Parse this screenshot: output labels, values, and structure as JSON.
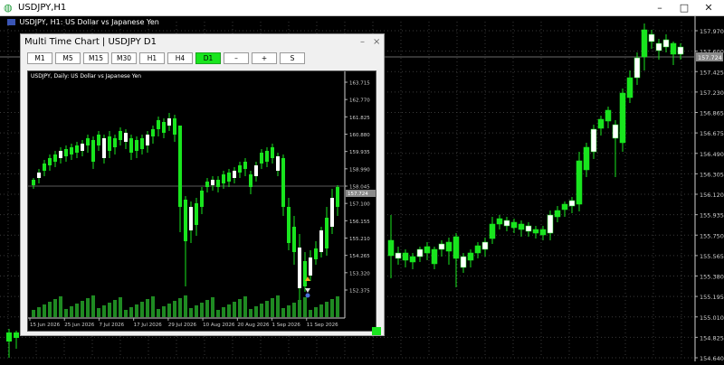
{
  "window": {
    "title": "USDJPY,H1",
    "icon": "metatrader-icon",
    "controls": [
      "–",
      "□",
      "✕"
    ]
  },
  "main_chart": {
    "caption": "USDJPY, H1:  US Dollar vs Japanese Yen",
    "current_price": "157.724",
    "price_axis": [
      "157.970",
      "157.600",
      "157.425",
      "157.230",
      "156.865",
      "156.675",
      "156.490",
      "156.305",
      "156.120",
      "155.935",
      "155.750",
      "155.565",
      "155.380",
      "155.195",
      "155.010",
      "154.825",
      "154.640"
    ],
    "colors": {
      "bull": "#ffffff",
      "bear": "#19e51e",
      "wick": "#19e51e",
      "grid": "#3a3a3a",
      "background": "#000000"
    }
  },
  "panel": {
    "title": "Multi Time Chart  |  USDJPY D1",
    "controls": [
      "–",
      "×"
    ],
    "timeframes": [
      {
        "label": "M1",
        "active": false
      },
      {
        "label": "M5",
        "active": false
      },
      {
        "label": "M15",
        "active": false
      },
      {
        "label": "M30",
        "active": false
      },
      {
        "label": "H1",
        "active": false
      },
      {
        "label": "H4",
        "active": false
      },
      {
        "label": "D1",
        "active": true
      },
      {
        "label": "–",
        "active": false
      },
      {
        "label": "+",
        "active": false
      },
      {
        "label": "S",
        "active": false
      }
    ],
    "active_color": "#19e51e"
  },
  "inner_chart": {
    "caption": "USDJPY, Daily:  US Dollar vs Japanese Yen",
    "current_price": "157.724",
    "level_label": "158.045",
    "price_axis": [
      "163.715",
      "162.770",
      "161.825",
      "160.880",
      "159.935",
      "158.990",
      "158.045",
      "157.100",
      "156.155",
      "155.210",
      "154.265",
      "153.320",
      "152.375"
    ],
    "date_axis": [
      "15 Jun 2026",
      "25 Jun 2026",
      "7 Jul 2026",
      "17 Jul 2026",
      "29 Jul 2026",
      "10 Aug 2026",
      "20 Aug 2026",
      "1 Sep 2026",
      "11 Sep 2026"
    ]
  }
}
